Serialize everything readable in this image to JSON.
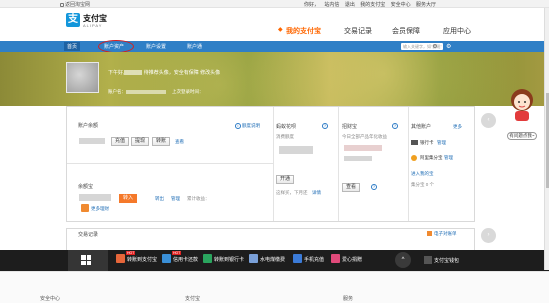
{
  "topbar": {
    "back_label": "返回淘宝网",
    "links": [
      "你好，",
      "站内信",
      "退出",
      "我的支付宝",
      "安全中心",
      "服务大厅"
    ]
  },
  "header": {
    "logo_glyph": "支",
    "logo_text": "支付宝",
    "logo_sub": "ALIPAY",
    "nav": [
      {
        "label": "我的支付宝",
        "active": true
      },
      {
        "label": "交易记录",
        "active": false
      },
      {
        "label": "会员保障",
        "active": false
      },
      {
        "label": "应用中心",
        "active": false
      }
    ]
  },
  "subnav": {
    "items": [
      "首页",
      "账户资产",
      "账户设置",
      "账户通"
    ],
    "search_placeholder": "输入关键字，如\"提现\"",
    "gear": "⚙"
  },
  "banner": {
    "greeting": "下午好,",
    "greeting_tip": "待推荐头像，安全有保障 修改头像",
    "account_label": "账户名：",
    "last_login": "上次登录时间："
  },
  "balance": {
    "title": "账户余额",
    "help_link": "额度说明",
    "buttons": [
      "充值",
      "提现",
      "转账"
    ],
    "view_link": "查看"
  },
  "yuebao": {
    "title": "余额宝",
    "button": "转入",
    "links": [
      "转出",
      "管理"
    ],
    "extra": "累计收益：",
    "more_link": "更多理财"
  },
  "huabei": {
    "title": "蚂蚁花呗",
    "sub": "消费额度",
    "button": "开通",
    "bottom_text": "这样买，下月还",
    "bottom_link": "详情"
  },
  "zhaocaibao": {
    "title": "招财宝",
    "sub1": "今日全部产品年化收益",
    "button": "查看"
  },
  "other": {
    "title": "其他账户",
    "more": "更多",
    "items": [
      {
        "label": "银行卡",
        "link": "管理"
      },
      {
        "label": "阿里集分宝",
        "link": "管理"
      }
    ],
    "new_link": "进入我的宝",
    "points": "集分宝 0 个"
  },
  "records": {
    "title": "交易记录",
    "ebill": "电子对账单"
  },
  "taskbar": {
    "items": [
      {
        "label": "转账到支付宝",
        "color": "#e6663a",
        "hot": "HOT"
      },
      {
        "label": "信用卡还款",
        "color": "#3a8fd6",
        "hot": "HOT"
      },
      {
        "label": "转账到银行卡",
        "color": "#2aa55e",
        "hot": ""
      },
      {
        "label": "水电煤缴费",
        "color": "#7aa0d8",
        "hot": ""
      },
      {
        "label": "手机充值",
        "color": "#3b7bd8",
        "hot": ""
      },
      {
        "label": "爱心捐赠",
        "color": "#e04a7a",
        "hot": ""
      }
    ],
    "arrow": "^",
    "right_label": "支付宝钱包"
  },
  "side": {
    "help_label": "有问题点我~"
  },
  "footer": {
    "labels": [
      "安全中心",
      "支付宝",
      "服务"
    ]
  }
}
